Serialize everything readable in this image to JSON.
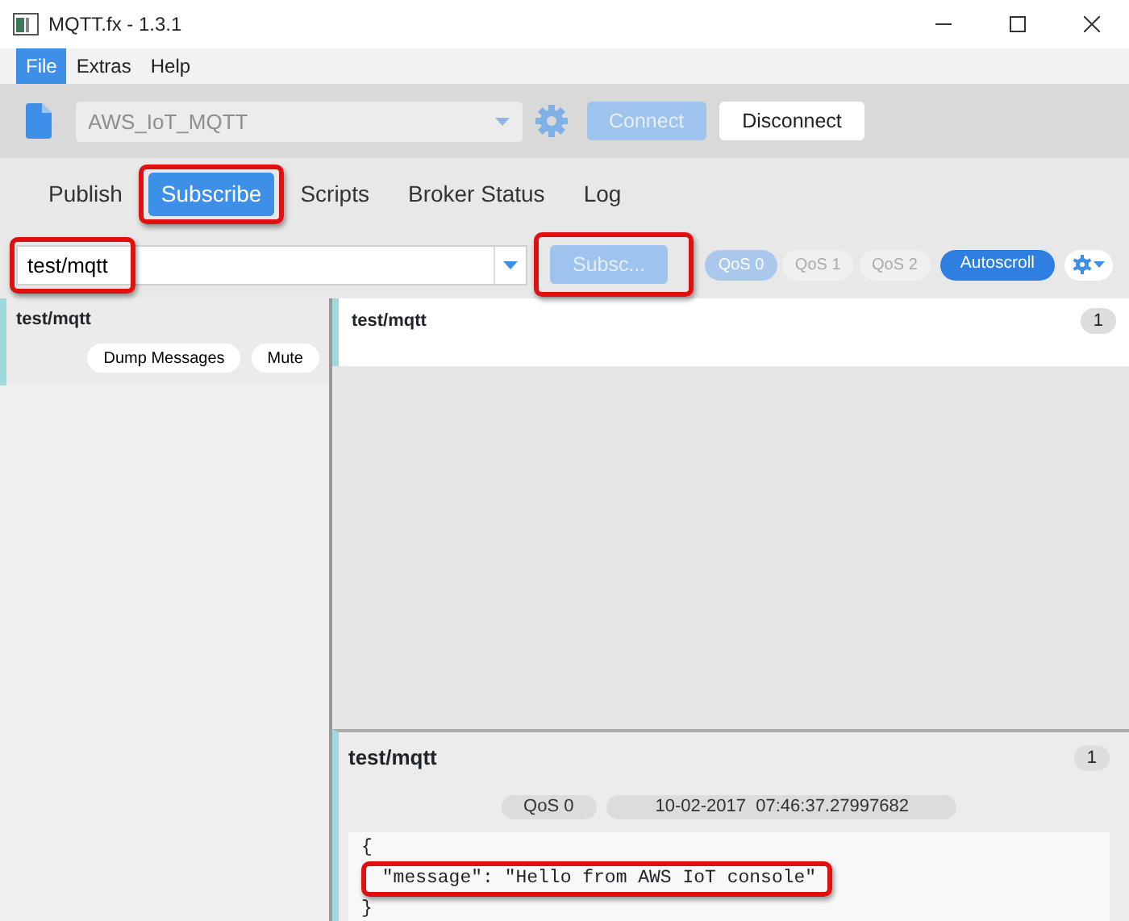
{
  "window": {
    "title": "MQTT.fx - 1.3.1"
  },
  "menu": [
    {
      "label": "File",
      "selected": true
    },
    {
      "label": "Extras",
      "selected": false
    },
    {
      "label": "Help",
      "selected": false
    }
  ],
  "toolbar": {
    "profile": {
      "value": "AWS_IoT_MQTT",
      "disabled": true
    },
    "buttons": [
      {
        "label": "Connect",
        "disabled": true
      },
      {
        "label": "Disconnect",
        "disabled": false
      }
    ]
  },
  "tabs": [
    {
      "label": "Publish",
      "selected": false,
      "highlighted": false
    },
    {
      "label": "Subscribe",
      "selected": true,
      "highlighted": true
    },
    {
      "label": "Scripts",
      "selected": false,
      "highlighted": false
    },
    {
      "label": "Broker Status",
      "selected": false,
      "highlighted": false
    },
    {
      "label": "Log",
      "selected": false,
      "highlighted": false
    }
  ],
  "subscribe_bar": {
    "topic": {
      "value": "test/mqtt",
      "highlighted": true
    },
    "subscribe_button": {
      "label": "Subsc...",
      "disabled": true,
      "highlighted": true
    },
    "qos": [
      {
        "label": "QoS 0",
        "selected": true
      },
      {
        "label": "QoS 1",
        "selected": false
      },
      {
        "label": "QoS 2",
        "selected": false
      }
    ],
    "autoscroll": {
      "label": "Autoscroll",
      "on": true
    }
  },
  "subscriptions": [
    {
      "topic": "test/mqtt",
      "buttons": [
        "Dump Messages",
        "Mute"
      ]
    }
  ],
  "messages": [
    {
      "topic": "test/mqtt",
      "count": "1"
    }
  ],
  "detail": {
    "topic": "test/mqtt",
    "count": "1",
    "qos": "QoS 0",
    "timestamp": "10-02-2017  07:46:37.27997682",
    "payload": [
      {
        "text": "{",
        "highlighted": false
      },
      {
        "text": " \"message\": \"Hello from AWS IoT console\"",
        "highlighted": true
      },
      {
        "text": "}",
        "highlighted": false
      }
    ]
  }
}
